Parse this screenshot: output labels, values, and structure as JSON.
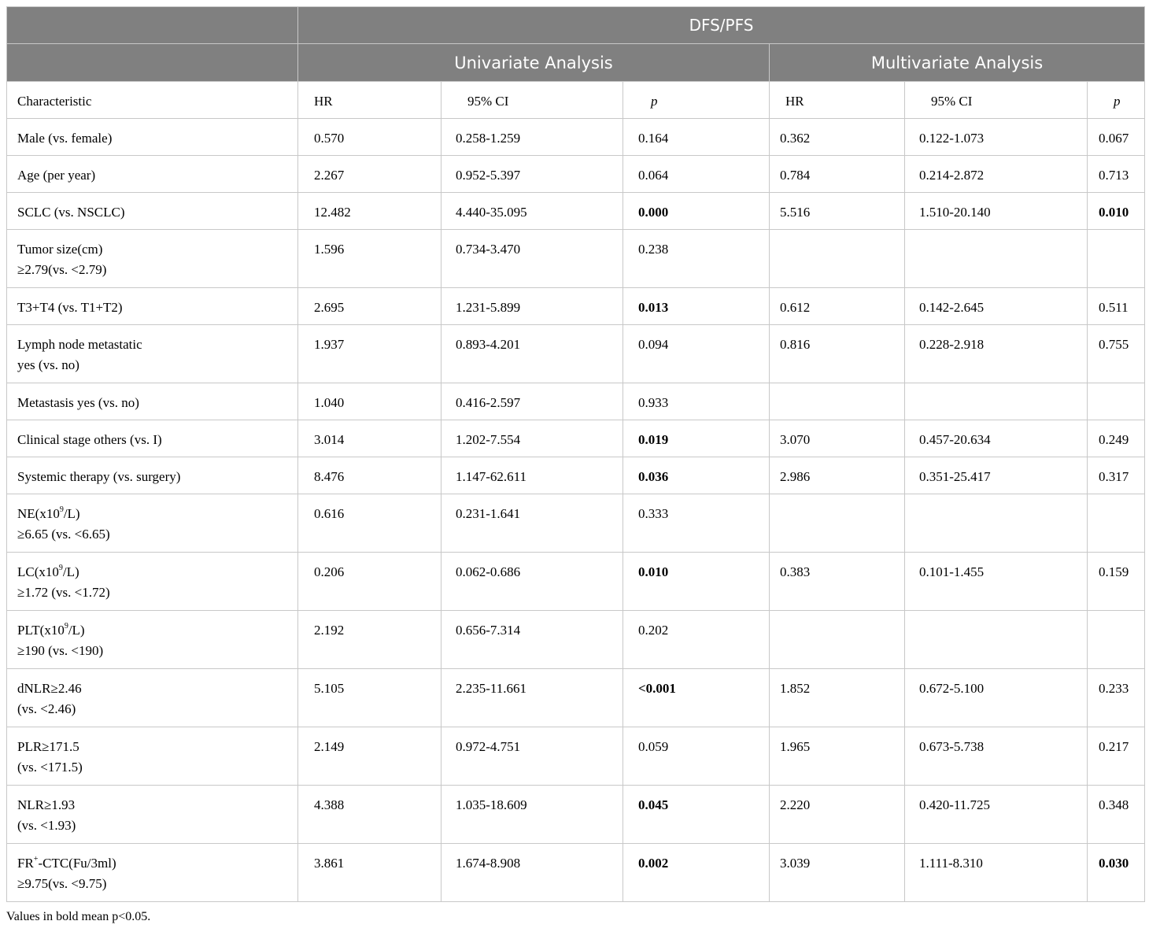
{
  "header": {
    "group": "DFS/PFS",
    "univariate": "Univariate Analysis",
    "multivariate": "Multivariate Analysis"
  },
  "columns": [
    "Characteristic",
    "HR",
    "95% CI",
    "p",
    "HR",
    "95% CI",
    "p"
  ],
  "rows": [
    {
      "label": [
        "Male (vs. female)"
      ],
      "uhr": "0.570",
      "uci": "0.258-1.259",
      "up": "0.164",
      "up_bold": false,
      "mhr": "0.362",
      "mci": "0.122-1.073",
      "mp": "0.067",
      "mp_bold": false
    },
    {
      "label": [
        "Age (per year)"
      ],
      "uhr": "2.267",
      "uci": "0.952-5.397",
      "up": "0.064",
      "up_bold": false,
      "mhr": "0.784",
      "mci": "0.214-2.872",
      "mp": "0.713",
      "mp_bold": false
    },
    {
      "label": [
        "SCLC (vs. NSCLC)"
      ],
      "uhr": "12.482",
      "uci": "4.440-35.095",
      "up": "0.000",
      "up_bold": true,
      "mhr": "5.516",
      "mci": "1.510-20.140",
      "mp": "0.010",
      "mp_bold": true
    },
    {
      "label": [
        "Tumor size(cm)",
        "≥2.79(vs. <2.79)"
      ],
      "uhr": "1.596",
      "uci": "0.734-3.470",
      "up": "0.238",
      "up_bold": false,
      "mhr": "",
      "mci": "",
      "mp": "",
      "mp_bold": false
    },
    {
      "label": [
        "T3+T4 (vs. T1+T2)"
      ],
      "uhr": "2.695",
      "uci": "1.231-5.899",
      "up": "0.013",
      "up_bold": true,
      "mhr": "0.612",
      "mci": "0.142-2.645",
      "mp": "0.511",
      "mp_bold": false
    },
    {
      "label": [
        "Lymph node metastatic",
        "yes (vs. no)"
      ],
      "uhr": "1.937",
      "uci": "0.893-4.201",
      "up": "0.094",
      "up_bold": false,
      "mhr": "0.816",
      "mci": "0.228-2.918",
      "mp": "0.755",
      "mp_bold": false
    },
    {
      "label": [
        "Metastasis yes (vs. no)"
      ],
      "uhr": "1.040",
      "uci": "0.416-2.597",
      "up": "0.933",
      "up_bold": false,
      "mhr": "",
      "mci": "",
      "mp": "",
      "mp_bold": false
    },
    {
      "label": [
        "Clinical stage others (vs. I)"
      ],
      "uhr": "3.014",
      "uci": "1.202-7.554",
      "up": "0.019",
      "up_bold": true,
      "mhr": "3.070",
      "mci": "0.457-20.634",
      "mp": "0.249",
      "mp_bold": false
    },
    {
      "label": [
        "Systemic therapy (vs. surgery)"
      ],
      "uhr": "8.476",
      "uci": "1.147-62.611",
      "up": "0.036",
      "up_bold": true,
      "mhr": "2.986",
      "mci": "0.351-25.417",
      "mp": "0.317",
      "mp_bold": false
    },
    {
      "label": [
        "NE(x10",
        "9",
        "/L)",
        "≥6.65 (vs. <6.65)"
      ],
      "sup": true,
      "uhr": "0.616",
      "uci": "0.231-1.641",
      "up": "0.333",
      "up_bold": false,
      "mhr": "",
      "mci": "",
      "mp": "",
      "mp_bold": false
    },
    {
      "label": [
        "LC(x10",
        "9",
        "/L)",
        "≥1.72 (vs. <1.72)"
      ],
      "sup": true,
      "uhr": "0.206",
      "uci": "0.062-0.686",
      "up": "0.010",
      "up_bold": true,
      "mhr": "0.383",
      "mci": "0.101-1.455",
      "mp": "0.159",
      "mp_bold": false
    },
    {
      "label": [
        "PLT(x10",
        "9",
        "/L)",
        "≥190 (vs. <190)"
      ],
      "sup": true,
      "uhr": "2.192",
      "uci": "0.656-7.314",
      "up": "0.202",
      "up_bold": false,
      "mhr": "",
      "mci": "",
      "mp": "",
      "mp_bold": false
    },
    {
      "label": [
        "dNLR≥2.46",
        "(vs. <2.46)"
      ],
      "uhr": "5.105",
      "uci": "2.235-11.661",
      "up": "<0.001",
      "up_bold": true,
      "mhr": "1.852",
      "mci": "0.672-5.100",
      "mp": "0.233",
      "mp_bold": false
    },
    {
      "label": [
        "PLR≥171.5",
        "(vs. <171.5)"
      ],
      "uhr": "2.149",
      "uci": "0.972-4.751",
      "up": "0.059",
      "up_bold": false,
      "mhr": "1.965",
      "mci": "0.673-5.738",
      "mp": "0.217",
      "mp_bold": false
    },
    {
      "label": [
        "NLR≥1.93",
        "(vs. <1.93)"
      ],
      "uhr": "4.388",
      "uci": "1.035-18.609",
      "up": "0.045",
      "up_bold": true,
      "mhr": "2.220",
      "mci": "0.420-11.725",
      "mp": "0.348",
      "mp_bold": false
    },
    {
      "label": [
        "FR",
        "+",
        "-CTC(Fu/3ml)",
        "≥9.75(vs. <9.75)"
      ],
      "sup": true,
      "uhr": "3.861",
      "uci": "1.674-8.908",
      "up": "0.002",
      "up_bold": true,
      "mhr": "3.039",
      "mci": "1.111-8.310",
      "mp": "0.030",
      "mp_bold": true
    }
  ],
  "footnote": "Values in bold mean p<0.05."
}
